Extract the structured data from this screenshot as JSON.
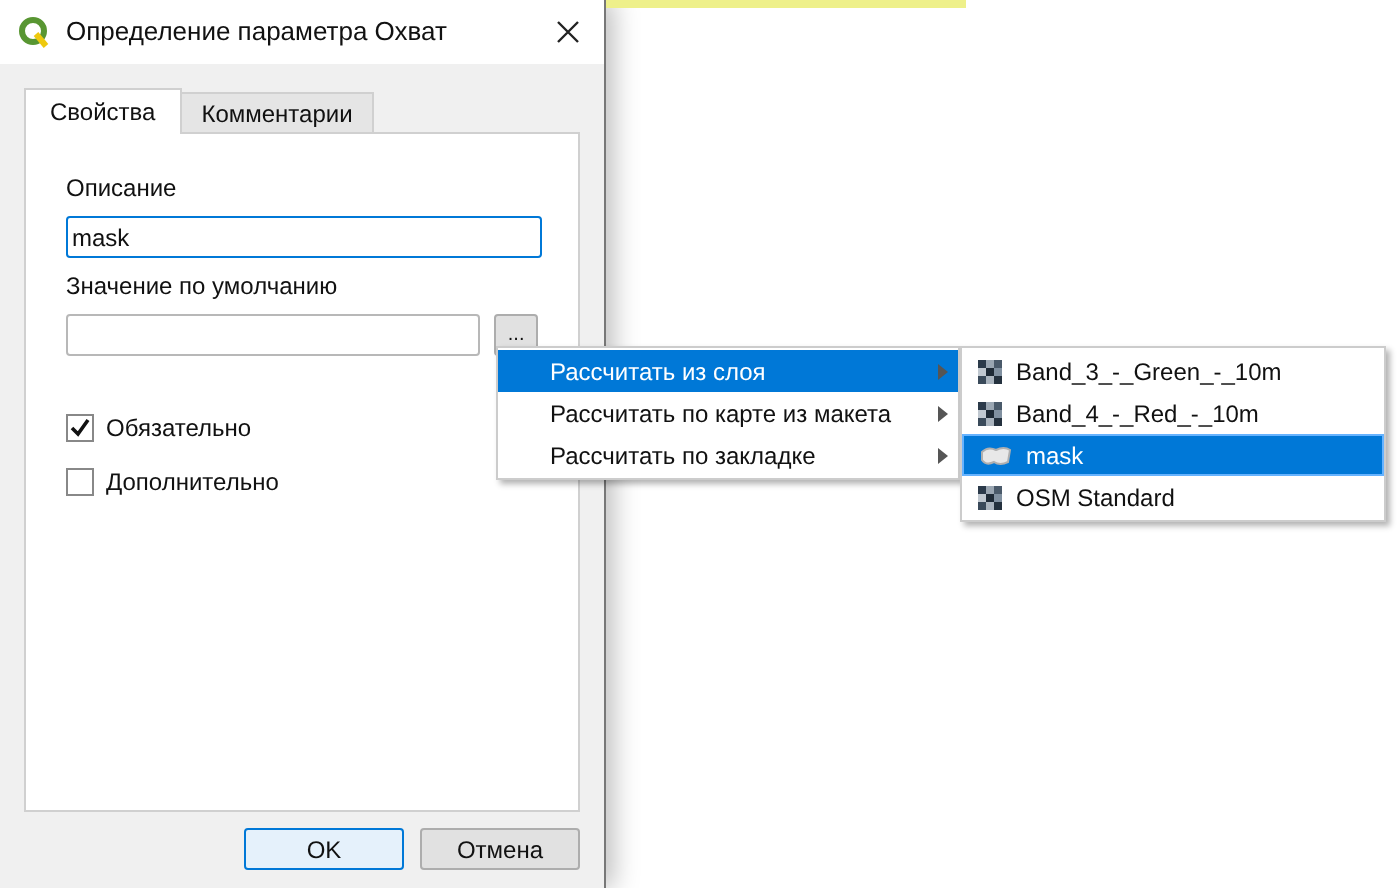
{
  "window": {
    "title": "Определение параметра Охват"
  },
  "tabs": [
    {
      "label": "Свойства",
      "selected": true
    },
    {
      "label": "Комментарии",
      "selected": false
    }
  ],
  "description": {
    "label": "Описание",
    "value": "mask"
  },
  "default_value": {
    "label": "Значение по умолчанию",
    "button": "..."
  },
  "checkboxes": [
    {
      "label": "Обязательно",
      "checked": true
    },
    {
      "label": "Дополнительно",
      "checked": false
    }
  ],
  "menu": {
    "items": [
      {
        "label": "Рассчитать из слоя",
        "selected": true
      },
      {
        "label": "Рассчитать по карте из макета",
        "selected": false
      },
      {
        "label": "Рассчитать по закладке",
        "selected": false
      }
    ]
  },
  "submenu": {
    "items": [
      {
        "label": "Band_3_-_Green_-_10m",
        "kind": "raster",
        "selected": false
      },
      {
        "label": "Band_4_-_Red_-_10m",
        "kind": "raster",
        "selected": false
      },
      {
        "label": "mask",
        "kind": "polygon",
        "selected": true
      },
      {
        "label": "OSM Standard",
        "kind": "raster",
        "selected": false
      }
    ]
  },
  "buttons": [
    {
      "label": "OK",
      "kind": "default"
    },
    {
      "label": "Отмена",
      "kind": "normal"
    }
  ]
}
